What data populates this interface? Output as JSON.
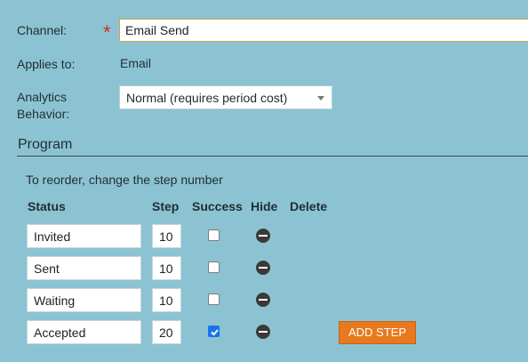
{
  "form": {
    "channel_label": "Channel:",
    "channel_value": "Email Send",
    "required_mark": "*",
    "applies_label": "Applies to:",
    "applies_value": "Email",
    "analytics_label_line1": "Analytics",
    "analytics_label_line2": "Behavior:",
    "analytics_value": "Normal (requires period cost)"
  },
  "program": {
    "title": "Program",
    "hint": "To reorder, change the step number",
    "columns": {
      "status": "Status",
      "step": "Step",
      "success": "Success",
      "hide": "Hide",
      "delete": "Delete"
    },
    "rows": [
      {
        "status": "Invited",
        "step": "10",
        "success": false
      },
      {
        "status": "Sent",
        "step": "10",
        "success": false
      },
      {
        "status": "Waiting",
        "step": "10",
        "success": false
      },
      {
        "status": "Accepted",
        "step": "20",
        "success": true
      }
    ],
    "add_step_label": "ADD STEP"
  }
}
